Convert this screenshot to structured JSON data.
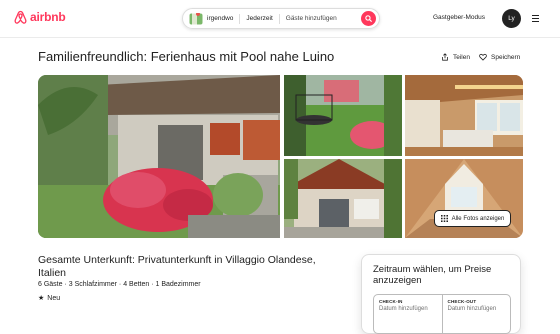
{
  "header": {
    "logo_text": "airbnb",
    "search": {
      "location": "irgendwo",
      "time": "Jederzeit",
      "guests": "Gäste hinzufügen"
    },
    "host_mode": "Gastgeber-Modus",
    "avatar_initials": "Ly",
    "accent_color": "#ff385c"
  },
  "listing": {
    "title": "Familienfreundlich: Ferienhaus mit Pool nahe Luino",
    "share_label": "Teilen",
    "save_label": "Speichern",
    "show_all_photos": "Alle Fotos anzeigen",
    "subtitle": "Gesamte Unterkunft: Privatunterkunft in Villaggio Olandese, Italien",
    "details": "6 Gäste · 3 Schlafzimmer · 4 Betten · 1 Badezimmer",
    "badge": "Neu"
  },
  "booking": {
    "title": "Zeitraum wählen, um Preise anzuzeigen",
    "checkin_label": "CHECK-IN",
    "checkin_value": "Datum hinzufügen",
    "checkout_label": "CHECK-OUT",
    "checkout_value": "Datum hinzufügen"
  }
}
